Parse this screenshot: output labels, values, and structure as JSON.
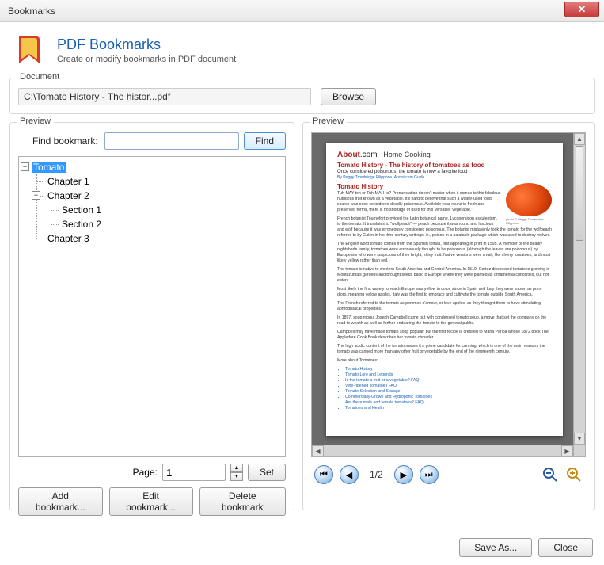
{
  "window": {
    "title": "Bookmarks"
  },
  "header": {
    "title": "PDF Bookmarks",
    "subtitle": "Create or modify bookmarks in PDF document"
  },
  "document": {
    "legend": "Document",
    "path": "C:\\Tomato History - The histor...pdf",
    "browse_label": "Browse"
  },
  "left": {
    "legend": "Preview",
    "find_label": "Find bookmark:",
    "find_button": "Find",
    "tree": {
      "root": "Tomato",
      "ch1": "Chapter 1",
      "ch2": "Chapter 2",
      "sec1": "Section 1",
      "sec2": "Section 2",
      "ch3": "Chapter 3"
    },
    "page_label": "Page:",
    "page_value": "1",
    "set_label": "Set",
    "add_label": "Add bookmark...",
    "edit_label": "Edit bookmark...",
    "delete_label": "Delete bookmark"
  },
  "right": {
    "legend": "Preview",
    "page_indicator": "1/2",
    "doc": {
      "logo_a": "About",
      "logo_b": ".com",
      "section": "Home Cooking",
      "title": "Tomato History - The history of tomatoes as food",
      "subtitle": "Once considered poisonous, the tomato is now a favorite food",
      "byline": "By Peggy Trowbridge Filippone, About.com Guide",
      "h_hist": "Tomato History",
      "p1": "Tuh-MAY-toh or Tuh-MAH-to? Pronunciation doesn't matter when it comes to this fabulous nutritious fruit known as a vegetable. It's hard to believe that such a widely-used food source was once considered deadly poisonous. Available year-round in fresh and preserved forms, there is no shortage of uses for this versatile \"vegetable.\"",
      "p2": "French botanist Tournefort provided the Latin botanical name, Lycopersicon esculentum, to the tomato. It translates to \"wolfpeach\" — peach because it was round and luscious and wolf because it was erroneously considered poisonous. The botanist mistakenly took the tomato for the wolfpeach referred to by Galen in his third century writings, ie., poison in a palatable package which was used to destroy wolves.",
      "p3": "The English word tomato comes from the Spanish tomatl, first appearing in print in 1595. A member of the deadly nightshade family, tomatoes were erroneously thought to be poisonous (although the leaves are poisonous) by Europeans who were suspicious of their bright, shiny fruit. Native versions were small, like cherry tomatoes, and most likely yellow rather than red.",
      "p4": "The tomato is native to western South America and Central America. In 1519, Cortez discovered tomatoes growing in Montezuma's gardens and brought seeds back to Europe where they were planted as ornamental curiosities, but not eaten.",
      "p5": "Most likely the first variety to reach Europe was yellow in color, since in Spain and Italy they were known as pomi d'oro, meaning yellow apples. Italy was the first to embrace and cultivate the tomato outside South America.",
      "p6": "The French referred to the tomato as pommes d'amour, or love apples, as they thought them to have stimulating aphrodisiacal properties.",
      "p7": "In 1897, soup mogul Joseph Campbell came out with condensed tomato soup, a move that set the company on the road to wealth as well as further endearing the tomato to the general public.",
      "p8": "Campbell may have made tomato soup popular, but the first recipe is credited to Maria Parloa whose 1872 book The Appledore Cook Book describes her tomato chowder.",
      "p9": "The high acidic content of the tomato makes it a prime candidate for canning, which is one of the main reasons the tomato was canned more than any other fruit or vegetable by the end of the nineteenth century.",
      "more": "More about Tomatoes:",
      "l1": "Tomato History",
      "l2": "Tomato Lore and Legends",
      "l3": "Is the tomato a fruit or a vegetable? FAQ",
      "l4": "Vine-ripened Tomatoes FAQ",
      "l5": "Tomato Selection and Storage",
      "l6": "Commercially-Grown and Hydroponic Tomatoes",
      "l7": "Are there male and female tomatoes? FAQ",
      "l8": "Tomatoes and Health",
      "caption": "photo © Peggy Trowbridge Filippone"
    }
  },
  "footer": {
    "save": "Save As...",
    "close": "Close"
  }
}
